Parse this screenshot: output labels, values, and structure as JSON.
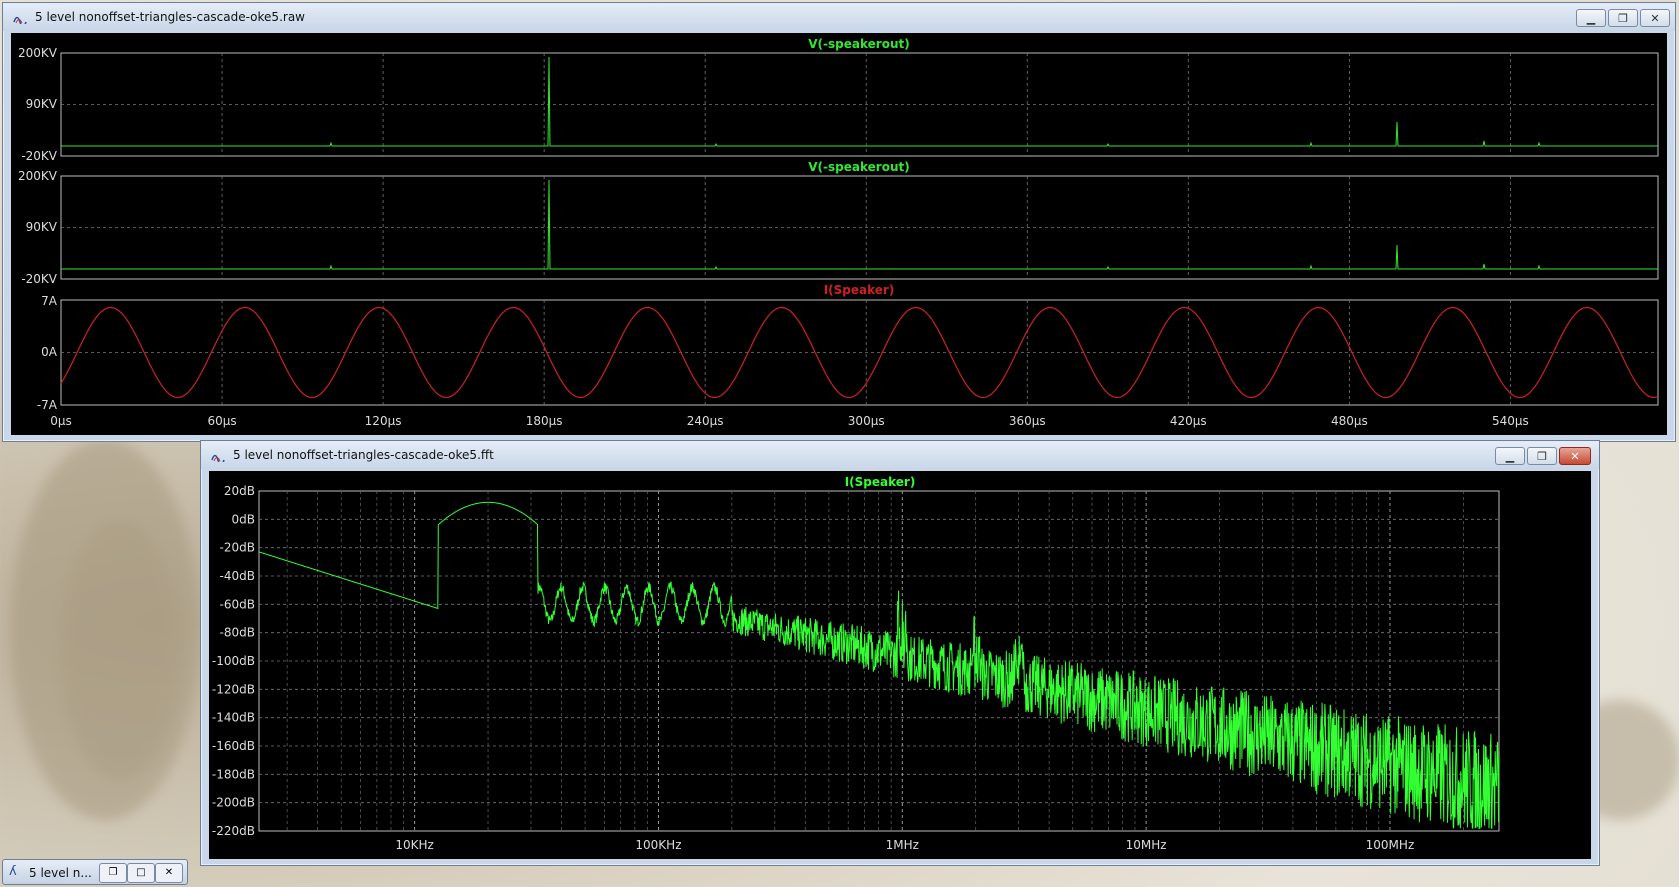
{
  "window1": {
    "title": "5 level nonoffset-triangles-cascade-oke5.raw",
    "controls": [
      "minimize",
      "restore",
      "close"
    ],
    "panes": [
      {
        "trace_label": "V(-speakerout)",
        "trace_color": "#33e633",
        "y_ticks": [
          "200KV",
          "90KV",
          "-20KV"
        ]
      },
      {
        "trace_label": "V(-speakerout)",
        "trace_color": "#33e633",
        "y_ticks": [
          "200KV",
          "90KV",
          "-20KV"
        ]
      },
      {
        "trace_label": "I(Speaker)",
        "trace_color": "#cc2222",
        "y_ticks": [
          "7A",
          "0A",
          "-7A"
        ]
      }
    ],
    "x_ticks": [
      "0µs",
      "60µs",
      "120µs",
      "180µs",
      "240µs",
      "300µs",
      "360µs",
      "420µs",
      "480µs",
      "540µs"
    ]
  },
  "window2": {
    "title": "5 level nonoffset-triangles-cascade-oke5.fft",
    "controls": [
      "minimize",
      "restore",
      "close"
    ],
    "trace_label": "I(Speaker)",
    "trace_color": "#33ff33",
    "y_ticks": [
      "20dB",
      "0dB",
      "-20dB",
      "-40dB",
      "-60dB",
      "-80dB",
      "-100dB",
      "-120dB",
      "-140dB",
      "-160dB",
      "-180dB",
      "-200dB",
      "-220dB"
    ],
    "x_ticks": [
      "10KHz",
      "100KHz",
      "1MHz",
      "10MHz",
      "100MHz"
    ]
  },
  "taskbar": {
    "label": "5 level n..."
  }
}
